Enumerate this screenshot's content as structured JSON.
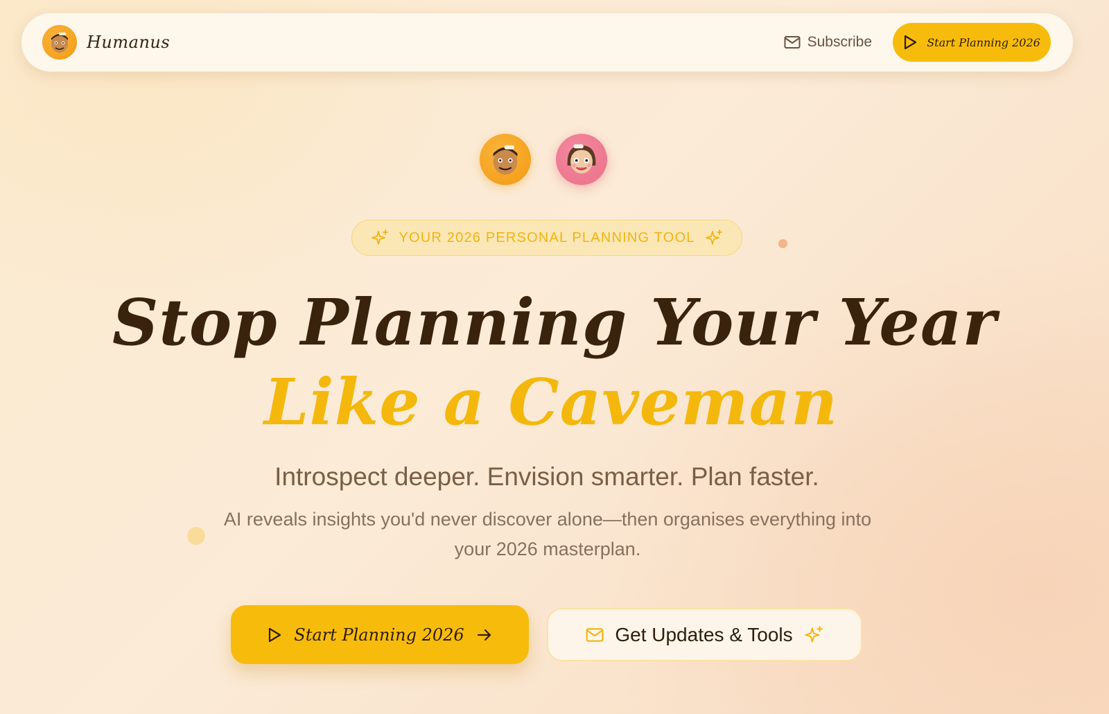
{
  "nav": {
    "brand_name": "Humanus",
    "subscribe_label": "Subscribe",
    "cta_label": "Start Planning 2026"
  },
  "hero": {
    "badge_text": "YOUR 2026 PERSONAL PLANNING TOOL",
    "headline_line1": "Stop Planning Your Year",
    "headline_line2": "Like a Caveman",
    "tagline": "Introspect deeper. Envision smarter. Plan faster.",
    "description": "AI reveals insights you'd never discover alone—then organises everything into your 2026 masterplan.",
    "primary_cta_label": "Start Planning 2026",
    "secondary_cta_label": "Get Updates & Tools"
  },
  "icons": {
    "brand_avatar": "caveman-avatar-icon",
    "hero_avatar_1": "caveman-avatar-icon",
    "hero_avatar_2": "cavewoman-avatar-icon",
    "subscribe": "mail-icon",
    "play": "play-icon",
    "sparkle": "sparkle-icon",
    "arrow": "arrow-right-icon"
  },
  "colors": {
    "accent": "#f7bc0b",
    "text_dark": "#3a230c",
    "text_muted": "#7a5e45",
    "avatar_orange": "#f29a14",
    "avatar_pink": "#ec6f86"
  }
}
